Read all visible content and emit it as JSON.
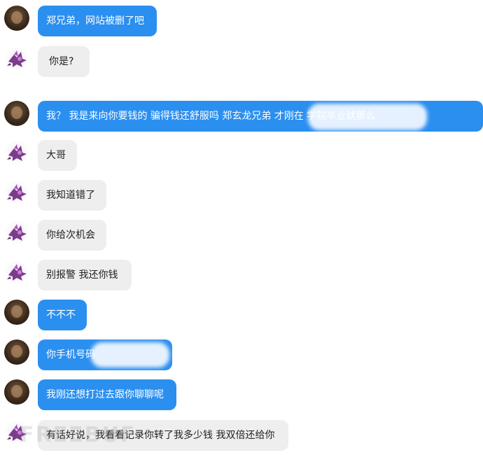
{
  "messages": [
    {
      "sender": "me",
      "text": "郑兄弟，网站被删了吧"
    },
    {
      "sender": "them",
      "text": "你是?"
    },
    {
      "sender": "me",
      "text": "我？ 我是来向你要钱的 骗得钱还舒服吗  郑玄龙兄弟  才刚在                                                学院毕业就那么"
    },
    {
      "sender": "them",
      "text": "大哥"
    },
    {
      "sender": "them",
      "text": "我知道错了"
    },
    {
      "sender": "them",
      "text": "你给次机会"
    },
    {
      "sender": "them",
      "text": "别报警 我还你钱"
    },
    {
      "sender": "me",
      "text": "不不不"
    },
    {
      "sender": "me",
      "text": "你手机号码"
    },
    {
      "sender": "me",
      "text": "我刚还想打过去跟你聊聊呢"
    },
    {
      "sender": "them",
      "text": "有话好说，我看看记录你转了我多少钱 我双倍还给你"
    }
  ],
  "watermark": "FREEBUF",
  "colors": {
    "me_bubble": "#2b8ff0",
    "them_bubble": "#eeeeee"
  }
}
